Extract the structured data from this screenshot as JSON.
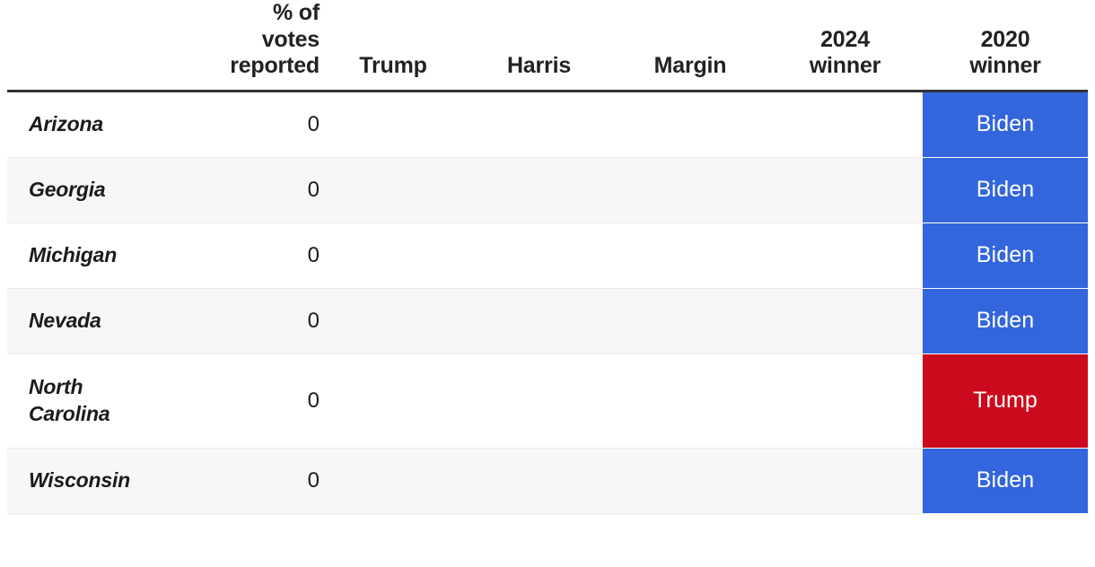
{
  "table": {
    "columns": [
      {
        "key": "state",
        "label": "",
        "align": "left"
      },
      {
        "key": "pct",
        "label": "% of\nvotes\nreported",
        "align": "right"
      },
      {
        "key": "trump",
        "label": "Trump",
        "align": "center"
      },
      {
        "key": "harris",
        "label": "Harris",
        "align": "center"
      },
      {
        "key": "margin",
        "label": "Margin",
        "align": "center"
      },
      {
        "key": "w2024",
        "label": "2024\nwinner",
        "align": "center"
      },
      {
        "key": "w2020",
        "label": "2020\nwinner",
        "align": "center"
      }
    ],
    "header": {
      "state": "",
      "pct": "% of\nvotes\nreported",
      "trump": "Trump",
      "harris": "Harris",
      "margin": "Margin",
      "winner_2024": "2024\nwinner",
      "winner_2020": "2020\nwinner"
    },
    "rows": [
      {
        "state": "Arizona",
        "pct": "0",
        "trump": "",
        "harris": "",
        "margin": "",
        "winner_2024": "",
        "winner_2024_color": "",
        "winner_2020": "Biden",
        "winner_2020_color": "#3366dd"
      },
      {
        "state": "Georgia",
        "pct": "0",
        "trump": "",
        "harris": "",
        "margin": "",
        "winner_2024": "",
        "winner_2024_color": "",
        "winner_2020": "Biden",
        "winner_2020_color": "#3366dd"
      },
      {
        "state": "Michigan",
        "pct": "0",
        "trump": "",
        "harris": "",
        "margin": "",
        "winner_2024": "",
        "winner_2024_color": "",
        "winner_2020": "Biden",
        "winner_2020_color": "#3366dd"
      },
      {
        "state": "Nevada",
        "pct": "0",
        "trump": "",
        "harris": "",
        "margin": "",
        "winner_2024": "",
        "winner_2024_color": "",
        "winner_2020": "Biden",
        "winner_2020_color": "#3366dd"
      },
      {
        "state": "North\nCarolina",
        "pct": "0",
        "trump": "",
        "harris": "",
        "margin": "",
        "winner_2024": "",
        "winner_2024_color": "",
        "winner_2020": "Trump",
        "winner_2020_color": "#cc0a1e"
      },
      {
        "state": "Wisconsin",
        "pct": "0",
        "trump": "",
        "harris": "",
        "margin": "",
        "winner_2024": "",
        "winner_2024_color": "",
        "winner_2020": "Biden",
        "winner_2020_color": "#3366dd"
      }
    ]
  },
  "colors": {
    "democrat": "#3366dd",
    "republican": "#cc0a1e",
    "header_rule": "#333333",
    "stripe": "#f7f7f7",
    "stripe_border": "#ececec",
    "text": "#1b1b1b"
  }
}
